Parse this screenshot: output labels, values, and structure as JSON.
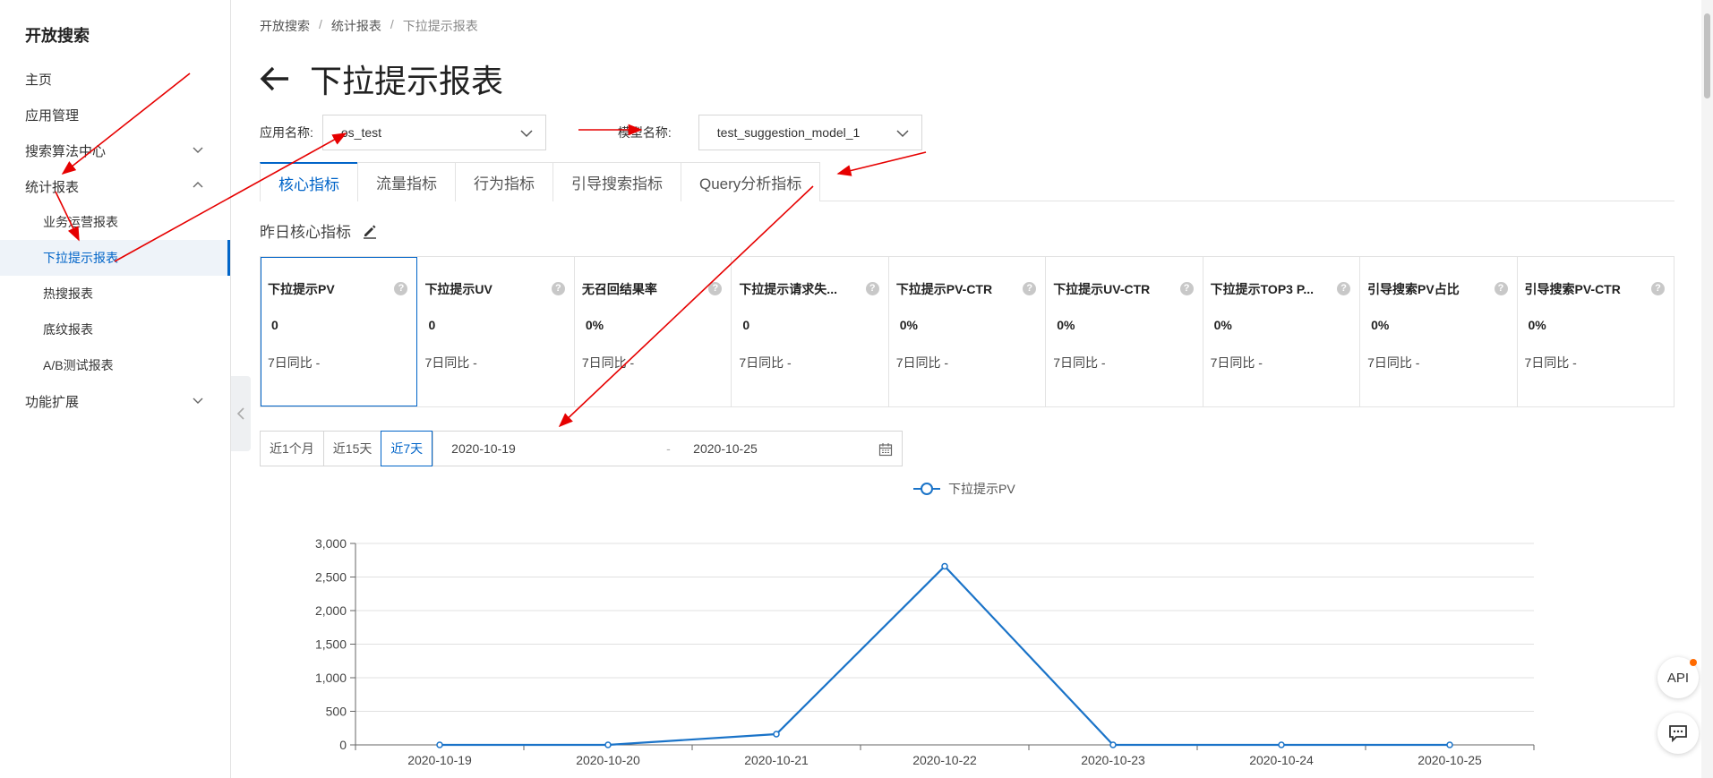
{
  "sidebar": {
    "brand": "开放搜索",
    "items": [
      {
        "label": "主页"
      },
      {
        "label": "应用管理"
      },
      {
        "label": "搜索算法中心"
      },
      {
        "label": "统计报表"
      },
      {
        "label": "业务运营报表"
      },
      {
        "label": "下拉提示报表"
      },
      {
        "label": "热搜报表"
      },
      {
        "label": "底纹报表"
      },
      {
        "label": "A/B测试报表"
      },
      {
        "label": "功能扩展"
      }
    ]
  },
  "breadcrumb": [
    "开放搜索",
    "统计报表",
    "下拉提示报表"
  ],
  "page_title": "下拉提示报表",
  "filters": {
    "app_label": "应用名称:",
    "app_value": "os_test",
    "model_label": "模型名称:",
    "model_value": "test_suggestion_model_1"
  },
  "tabs": [
    "核心指标",
    "流量指标",
    "行为指标",
    "引导搜索指标",
    "Query分析指标"
  ],
  "section_title": "昨日核心指标",
  "metrics": [
    {
      "title": "下拉提示PV",
      "value": "0",
      "compare": "7日同比 -"
    },
    {
      "title": "下拉提示UV",
      "value": "0",
      "compare": "7日同比 -"
    },
    {
      "title": "无召回结果率",
      "value": "0%",
      "compare": "7日同比 -"
    },
    {
      "title": "下拉提示请求失...",
      "value": "0",
      "compare": "7日同比 -"
    },
    {
      "title": "下拉提示PV-CTR",
      "value": "0%",
      "compare": "7日同比 -"
    },
    {
      "title": "下拉提示UV-CTR",
      "value": "0%",
      "compare": "7日同比 -"
    },
    {
      "title": "下拉提示TOP3 P...",
      "value": "0%",
      "compare": "7日同比 -"
    },
    {
      "title": "引导搜索PV占比",
      "value": "0%",
      "compare": "7日同比 -"
    },
    {
      "title": "引导搜索PV-CTR",
      "value": "0%",
      "compare": "7日同比 -"
    }
  ],
  "date_filter": {
    "quick": [
      "近1个月",
      "近15天",
      "近7天"
    ],
    "start": "2020-10-19",
    "separator": "-",
    "end": "2020-10-25"
  },
  "chart_data": {
    "type": "line",
    "categories": [
      "2020-10-19",
      "2020-10-20",
      "2020-10-21",
      "2020-10-22",
      "2020-10-23",
      "2020-10-24",
      "2020-10-25"
    ],
    "series": [
      {
        "name": "下拉提示PV",
        "values": [
          0,
          0,
          160,
          2660,
          0,
          0,
          0
        ]
      }
    ],
    "yticks": [
      "0",
      "500",
      "1,000",
      "1,500",
      "2,000",
      "2,500",
      "3,000"
    ],
    "ylim": [
      0,
      3000
    ],
    "legend": "top-center",
    "color": "#1a73c8"
  },
  "float_buttons": {
    "api": "API"
  },
  "colors": {
    "accent": "#0064c8",
    "annotation": "#e60000"
  }
}
